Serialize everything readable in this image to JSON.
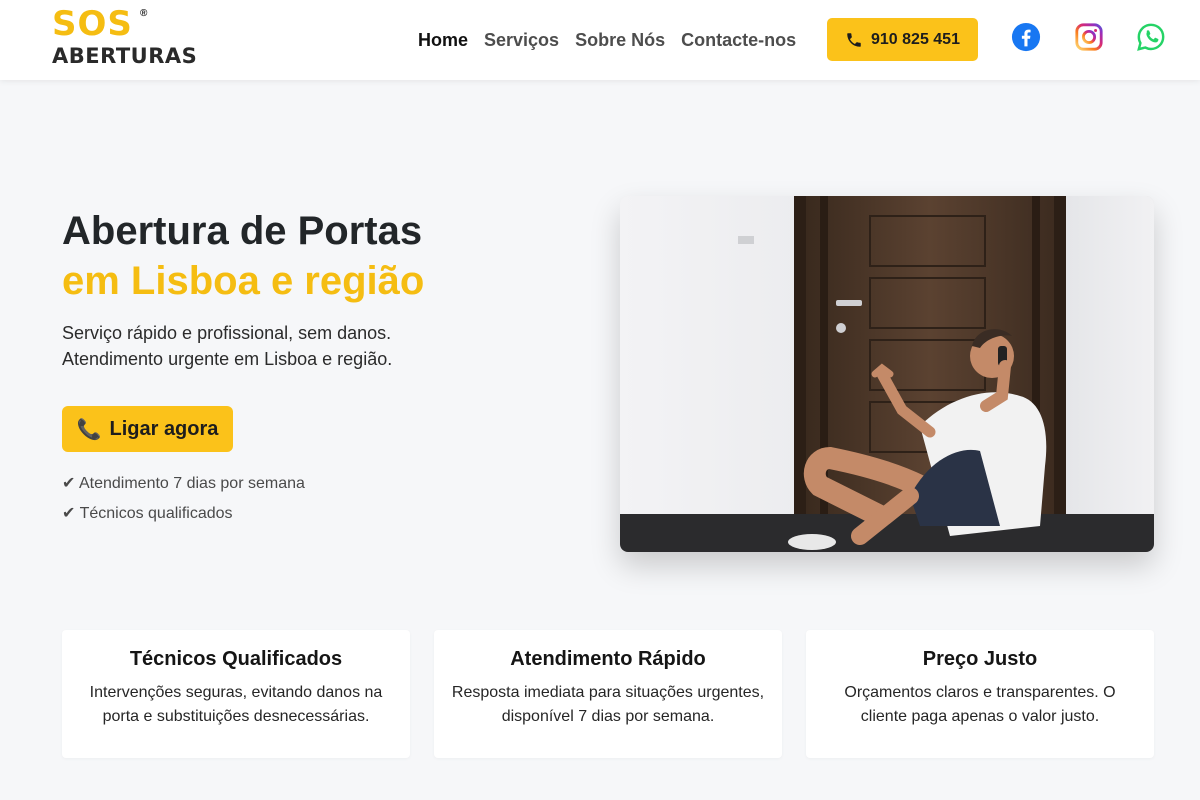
{
  "brand": {
    "logo_top": "SOS",
    "logo_reg": "®",
    "logo_bottom": "ABERTURAS",
    "accent_color": "#fbc21a"
  },
  "nav": {
    "items": [
      {
        "label": "Home",
        "active": true
      },
      {
        "label": "Serviços",
        "active": false
      },
      {
        "label": "Sobre Nós",
        "active": false
      },
      {
        "label": "Contacte-nos",
        "active": false
      }
    ],
    "phone_label": "910 825 451",
    "phone_icon": "phone-icon",
    "social": [
      "facebook-icon",
      "instagram-icon",
      "whatsapp-icon"
    ]
  },
  "hero": {
    "title_line1": "Abertura de Portas",
    "title_line2": "em Lisboa e região",
    "desc_line1": "Serviço rápido e profissional, sem danos.",
    "desc_line2": "Atendimento urgente em Lisboa e região.",
    "cta_icon": "📞",
    "cta_label": "Ligar agora",
    "checks": [
      "✔ Atendimento 7 dias por semana",
      "✔ Técnicos qualificados"
    ]
  },
  "features": [
    {
      "title": "Técnicos Qualificados",
      "text": "Intervenções seguras, evitando danos na porta e substituições desnecessárias."
    },
    {
      "title": "Atendimento Rápido",
      "text": "Resposta imediata para situações urgentes, disponível 7 dias por semana."
    },
    {
      "title": "Preço Justo",
      "text": "Orçamentos claros e transparentes. O cliente paga apenas o valor justo."
    }
  ]
}
